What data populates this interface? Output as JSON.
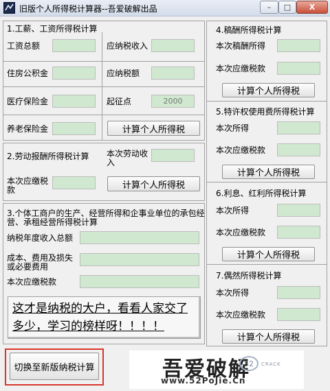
{
  "window": {
    "title": "旧版个人所得税计算器--吾爱破解出品",
    "minimize": "–",
    "maximize": "□",
    "close": "X"
  },
  "salary": {
    "heading": "1.工薪、工资所得税计算",
    "total_label": "工资总额",
    "payable_income_label": "应纳税收入",
    "housing_fund_label": "住房公积金",
    "tax_payable_label": "应纳税额",
    "medical_label": "医疗保险金",
    "threshold_label": "起征点",
    "threshold_value": "2000",
    "pension_label": "养老保险金",
    "calc_button": "计算个人所得税"
  },
  "labor": {
    "heading": "2.劳动报酬所得税计算",
    "income_label": "本次劳动收入",
    "tax_label": "本次应缴税款",
    "calc_button": "计算个人所得税"
  },
  "business": {
    "heading": "3.个体工商户的生产、经营所得和企事业单位的承包经营、承租经营所得税计算",
    "annual_income_label": "纳税年度收入总额",
    "cost_label": "成本、费用及损失或必要费用",
    "tax_label": "本次应缴税款"
  },
  "promo": {
    "text": "这才是纳税的大户，看看人家交了多少，学习的榜样呀！！！！"
  },
  "switch_button": "切换至新版纳税计算",
  "logo": {
    "main": "吾爱破解",
    "badge": "52",
    "crack": "CRACK",
    "url": "www.52PoJie.Cn"
  },
  "royalty": {
    "heading": "4.稿酬所得税计算",
    "income_label": "本次稿酬所得",
    "tax_label": "本次应缴税款",
    "calc_button": "计算个人所得税"
  },
  "license": {
    "heading": "5.特许权使用费所得税计算",
    "income_label": "本次所得",
    "tax_label": "本次应缴税款",
    "calc_button": "计算个人所得税"
  },
  "interest": {
    "heading": "6.利息、红利所得税计算",
    "income_label": "本次所得",
    "tax_label": "本次应缴税款",
    "calc_button": "计算个人所得税"
  },
  "incidental": {
    "heading": "7.偶然所得税计算",
    "income_label": "本次所得",
    "tax_label": "本次应缴税款",
    "calc_button": "计算个人所得税"
  }
}
